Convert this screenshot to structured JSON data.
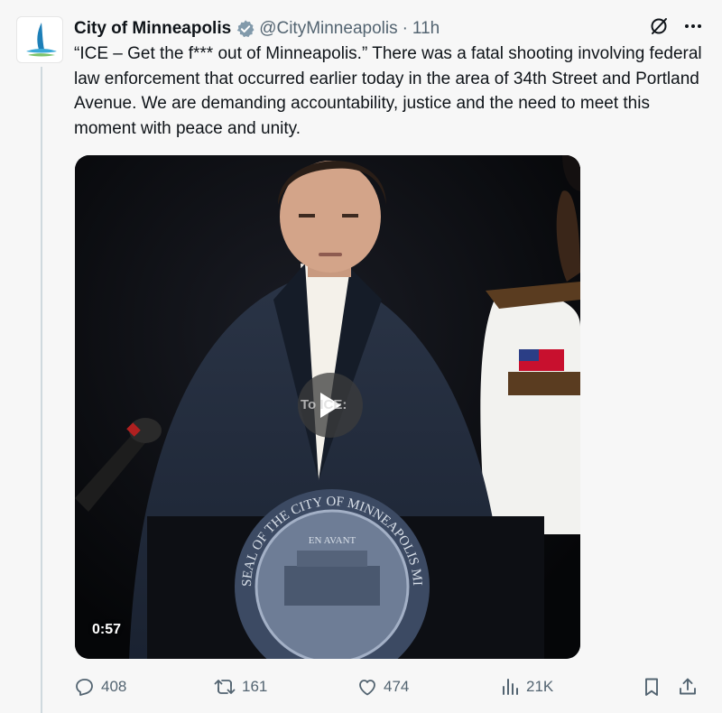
{
  "tweet": {
    "author_name": "City of Minneapolis",
    "handle": "@CityMinneapolis",
    "separator": "·",
    "time": "11h",
    "text": "“ICE – Get the f*** out of Minneapolis.” There was a fatal shooting involving federal law enforcement that occurred earlier today in the area of 34th Street and Portland Avenue. We are demanding accountability, justice and the need to meet this moment with peace and unity."
  },
  "media": {
    "duration": "0:57",
    "overlay_text": "To ICE:",
    "seal_text": "SEAL OF THE CITY OF MINNEAPOLIS MINN",
    "seal_motto": "EN AVANT"
  },
  "actions": {
    "replies": "408",
    "reposts": "161",
    "likes": "474",
    "views": "21K"
  },
  "colors": {
    "text": "#0f1419",
    "muted": "#536471",
    "verified": "#829aab",
    "background": "#f7f7f7"
  },
  "icons": [
    "slash-circle-icon",
    "more-icon",
    "verified-badge-icon",
    "play-icon",
    "reply-icon",
    "repost-icon",
    "like-icon",
    "views-icon",
    "bookmark-icon",
    "share-icon"
  ]
}
